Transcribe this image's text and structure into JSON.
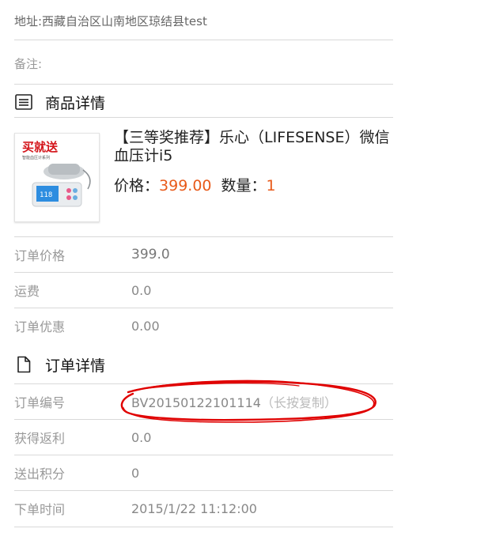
{
  "address": {
    "text": "地址:西藏自治区山南地区琼结县test"
  },
  "remark": {
    "label": "备注:"
  },
  "goods_section": {
    "title": "商品详情",
    "icon": "list-icon"
  },
  "product": {
    "thumb_badge": "买就送",
    "thumb_sub": "智能血压计系列",
    "name": "【三等奖推荐】乐心（LIFESENSE）微信血压计i5",
    "price_label": "价格：",
    "price_value": "399.00",
    "qty_label": "数量：",
    "qty_value": "1"
  },
  "price_rows": [
    {
      "label": "订单价格",
      "value": "399.0"
    },
    {
      "label": "运费",
      "value": "0.0"
    },
    {
      "label": "订单优惠",
      "value": "0.00"
    }
  ],
  "order_section": {
    "title": "订单详情",
    "icon": "document-icon"
  },
  "order_rows": [
    {
      "label": "订单编号",
      "value": "BV20150122101114",
      "hint": "（长按复制）"
    },
    {
      "label": "获得返利",
      "value": "0.0"
    },
    {
      "label": "送出积分",
      "value": "0"
    },
    {
      "label": "下单时间",
      "value": "2015/1/22 11:12:00"
    }
  ],
  "colors": {
    "accent": "#e85a1a",
    "annotation_red": "#e00000",
    "divider": "#d9d9d9"
  }
}
